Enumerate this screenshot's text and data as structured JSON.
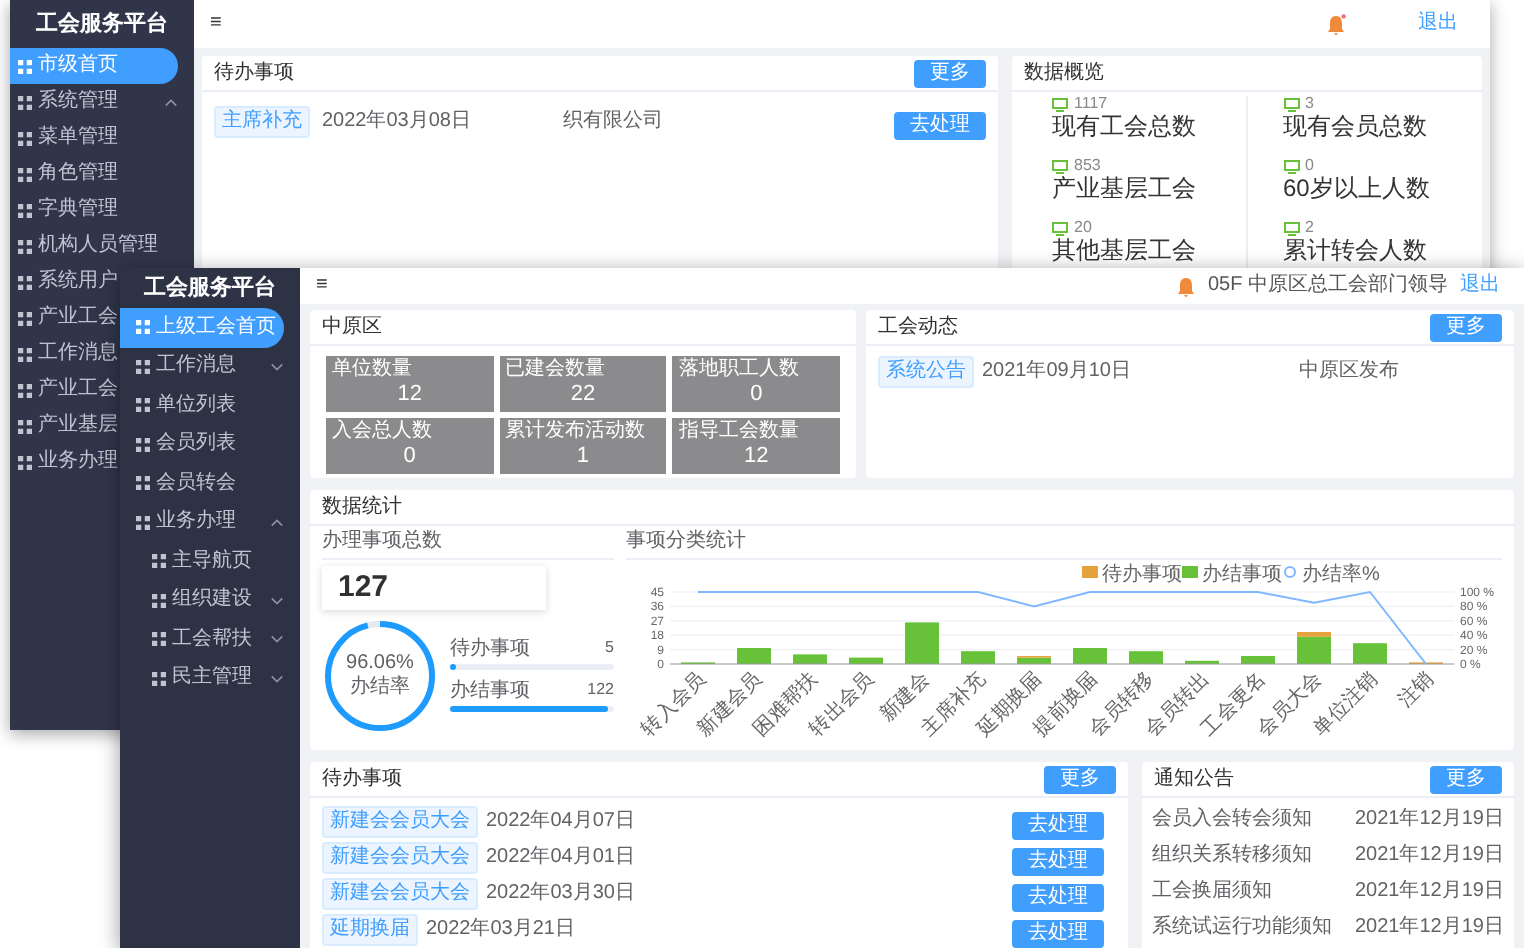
{
  "back_window": {
    "sidebar": {
      "title": "工会服务平台",
      "items": [
        {
          "label": "市级首页",
          "selected": true
        },
        {
          "label": "系统管理",
          "selected": false,
          "expanded": true,
          "children": [
            {
              "label": "菜单管理",
              "selected": false
            },
            {
              "label": "角色管理",
              "selected": false
            },
            {
              "label": "字典管理",
              "selected": false
            },
            {
              "label": "机构人员管理",
              "selected": false
            },
            {
              "label": "系统用户",
              "selected": false
            },
            {
              "label": "产业工会",
              "selected": false
            }
          ]
        },
        {
          "label": "工作消息",
          "selected": false
        },
        {
          "label": "产业工会",
          "selected": false
        },
        {
          "label": "产业基层",
          "selected": false
        },
        {
          "label": "业务办理",
          "selected": false
        }
      ]
    },
    "header": {
      "menu_glyph": "≡",
      "notification": true,
      "logout": "退出"
    },
    "todo": {
      "title": "待办事项",
      "more": "更多",
      "rows": [
        {
          "tag": "主席补充",
          "date": "2022年03月08日",
          "org": "织有限公司",
          "action": "去处理"
        }
      ]
    },
    "overview": {
      "title": "数据概览",
      "items": [
        {
          "value": "1117",
          "label": "现有工会总数"
        },
        {
          "value": "3",
          "label": "现有会员总数"
        },
        {
          "value": "853",
          "label": "产业基层工会"
        },
        {
          "value": "0",
          "label": "60岁以上人数"
        },
        {
          "value": "20",
          "label": "其他基层工会"
        },
        {
          "value": "2",
          "label": "累计转会人数"
        }
      ]
    }
  },
  "front_window": {
    "sidebar": {
      "title": "工会服务平台",
      "items": [
        {
          "label": "上级工会首页",
          "selected": true
        },
        {
          "label": "工作消息",
          "selected": false,
          "expanded": false
        },
        {
          "label": "单位列表",
          "selected": false
        },
        {
          "label": "会员列表",
          "selected": false
        },
        {
          "label": "会员转会",
          "selected": false
        },
        {
          "label": "业务办理",
          "selected": false,
          "expanded": true,
          "children": [
            {
              "label": "主导航页",
              "selected": false
            },
            {
              "label": "组织建设",
              "selected": false,
              "expanded": false
            },
            {
              "label": "工会帮扶",
              "selected": false,
              "expanded": false
            },
            {
              "label": "民主管理",
              "selected": false,
              "expanded": false
            }
          ]
        }
      ]
    },
    "header": {
      "menu_glyph": "≡",
      "notification": false,
      "user": "05F 中原区总工会部门领导",
      "logout": "退出"
    },
    "district": {
      "title": "中原区",
      "tiles": [
        {
          "label": "单位数量",
          "value": "12"
        },
        {
          "label": "已建会数量",
          "value": "22"
        },
        {
          "label": "落地职工人数",
          "value": "0"
        },
        {
          "label": "入会总人数",
          "value": "0"
        },
        {
          "label": "累计发布活动数",
          "value": "1"
        },
        {
          "label": "指导工会数量",
          "value": "12"
        }
      ]
    },
    "news": {
      "title": "工会动态",
      "more": "更多",
      "rows": [
        {
          "tag": "系统公告",
          "date": "2021年09月10日",
          "publisher": "中原区发布"
        }
      ]
    },
    "stats": {
      "title": "数据统计",
      "total_title": "办理事项总数",
      "total": "127",
      "rate": {
        "text": "96.06% 办结率",
        "level": 0.9606
      },
      "bars": [
        {
          "label": "待办事项",
          "count": "5",
          "level": 0.04
        },
        {
          "label": "办结事项",
          "count": "122",
          "level": 0.96
        }
      ],
      "chart_title": "事项分类统计",
      "chart_data": {
        "type": "bar",
        "stacked": true,
        "categories": [
          "转入会员",
          "新建会员",
          "困难帮扶",
          "转出会员",
          "新建会",
          "主席补充",
          "延期换届",
          "提前换届",
          "会员转移",
          "会员转出",
          "工会更名",
          "会员大会",
          "单位注销",
          "注销"
        ],
        "series": [
          {
            "name": "待办事项",
            "color": "#e6a23c",
            "values": [
              0,
              0,
              0,
              0,
              0,
              0,
              1,
              0,
              0,
              0,
              0,
              3,
              0,
              1
            ]
          },
          {
            "name": "办结事项",
            "color": "#67c23a",
            "values": [
              1,
              10,
              6,
              4,
              26,
              8,
              4,
              10,
              8,
              2,
              5,
              17,
              13,
              0
            ]
          }
        ],
        "grid": true,
        "legend": "upper center",
        "ylim": [
          0,
          45
        ],
        "yticks": [
          0,
          9,
          18,
          27,
          36,
          45
        ]
      },
      "rate_line": {
        "chart_data": {
          "type": "line",
          "categories": [
            null,
            null,
            null,
            null,
            null,
            null,
            null,
            null,
            null,
            null,
            null,
            null,
            null,
            null
          ],
          "series": [
            {
              "name": "办结率%",
              "color": "#7fb8ff",
              "values": [
                100,
                100,
                100,
                100,
                100,
                100,
                80,
                100,
                100,
                100,
                100,
                85,
                100,
                0
              ]
            }
          ],
          "legend": "upper center",
          "ylim": [
            0,
            100
          ],
          "yticks": [
            {
              "value": 0,
              "label": "0 %"
            },
            {
              "value": 20,
              "label": "20 %"
            },
            {
              "value": 40,
              "label": "40 %"
            },
            {
              "value": 60,
              "label": "60 %"
            },
            {
              "value": 80,
              "label": "80 %"
            },
            {
              "value": 100,
              "label": "100 %"
            }
          ]
        }
      }
    },
    "todo": {
      "title": "待办事项",
      "more": "更多",
      "rows": [
        {
          "tag": "新建会会员大会",
          "date": "2022年04月07日",
          "action": "去处理"
        },
        {
          "tag": "新建会会员大会",
          "date": "2022年04月01日",
          "action": "去处理"
        },
        {
          "tag": "新建会会员大会",
          "date": "2022年03月30日",
          "action": "去处理"
        },
        {
          "tag": "延期换届",
          "date": "2022年03月21日",
          "action": "去处理"
        }
      ]
    },
    "notices": {
      "title": "通知公告",
      "more": "更多",
      "rows": [
        {
          "title": "会员入会转会须知",
          "date": "2021年12月19日"
        },
        {
          "title": "组织关系转移须知",
          "date": "2021年12月19日"
        },
        {
          "title": "工会换届须知",
          "date": "2021年12月19日"
        },
        {
          "title": "系统试运行功能须知",
          "date": "2021年12月19日"
        }
      ]
    }
  }
}
